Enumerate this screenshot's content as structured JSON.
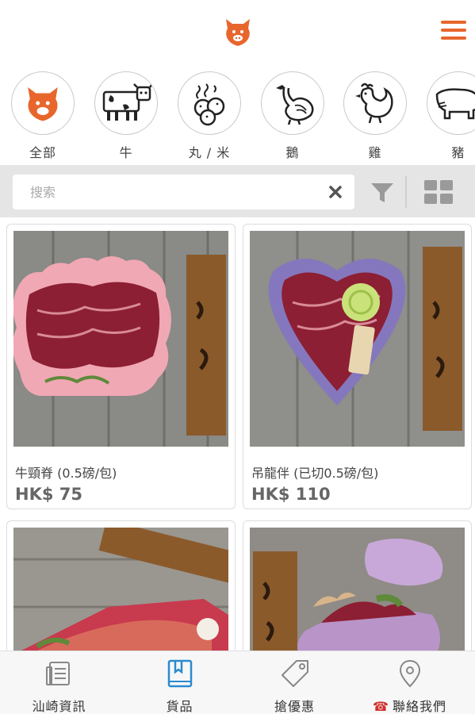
{
  "header": {
    "logo_icon": "pig-face-logo-icon",
    "menu_icon": "hamburger-menu-icon",
    "accent_color": "#e8662c"
  },
  "categories": [
    {
      "label": "全部",
      "icon": "pig-face-icon"
    },
    {
      "label": "牛",
      "icon": "cow-icon"
    },
    {
      "label": "丸 / 米",
      "icon": "fish-balls-icon"
    },
    {
      "label": "鵝",
      "icon": "goose-icon"
    },
    {
      "label": "雞",
      "icon": "chicken-icon"
    },
    {
      "label": "豬",
      "icon": "pig-icon"
    }
  ],
  "search": {
    "placeholder": "搜索",
    "value": ""
  },
  "products": [
    {
      "name": "牛頸脊 (0.5磅/包)",
      "price": "HK$ 75"
    },
    {
      "name": "吊龍伴 (已切0.5磅/包)",
      "price": "HK$ 110"
    },
    {
      "name": "",
      "price": ""
    },
    {
      "name": "",
      "price": ""
    }
  ],
  "nav": [
    {
      "label": "汕崎資訊",
      "icon": "news-icon"
    },
    {
      "label": "貨品",
      "icon": "book-icon",
      "active": true
    },
    {
      "label": "搶優惠",
      "icon": "tag-icon"
    },
    {
      "label": "聯絡我們",
      "icon": "location-pin-icon",
      "prefix_icon": "phone-icon"
    }
  ]
}
